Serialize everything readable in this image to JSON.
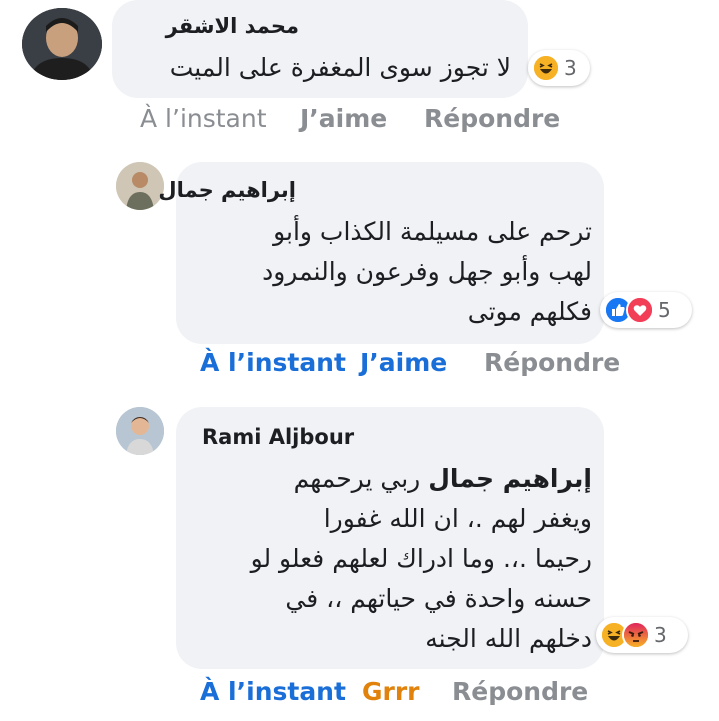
{
  "comments": [
    {
      "author": "محمد الاشقر",
      "lines": [
        "لا تجوز سوى المغفرة على الميت"
      ],
      "reaction_count": "3",
      "reactions": [
        "haha-icon"
      ],
      "time": "À l’instant",
      "like": "J’aime",
      "reply": "Répondre"
    },
    {
      "author": "إبراهيم جمال",
      "lines": [
        "ترحم على مسيلمة الكذاب وأبو",
        "لهب وأبو جهل وفرعون والنمرود",
        "فكلهم موتى"
      ],
      "reaction_count": "5",
      "reactions": [
        "like-icon",
        "love-icon"
      ],
      "time": "À l’instant",
      "like": "J’aime",
      "reply": "Répondre"
    },
    {
      "author": "Rami Aljbour",
      "mention": "إبراهيم جمال",
      "first_line_rest": "ربي يرحمهم",
      "lines": [
        "ويغفر لهم .، ان الله غفورا",
        "رحيما .،. وما ادراك لعلهم فعلو لو",
        "حسنه واحدة في حياتهم ،، في",
        "دخلهم الله الجنه"
      ],
      "reaction_count": "3",
      "reactions": [
        "haha-icon",
        "angry-icon"
      ],
      "time": "À l’instant",
      "like": "Grrr",
      "reply": "Répondre"
    }
  ],
  "colors": {
    "bubble": "#f0f2f5",
    "link_blue": "#1a6ed8",
    "meta_gray": "#8a8d91",
    "grrr_orange": "#e0820b"
  }
}
